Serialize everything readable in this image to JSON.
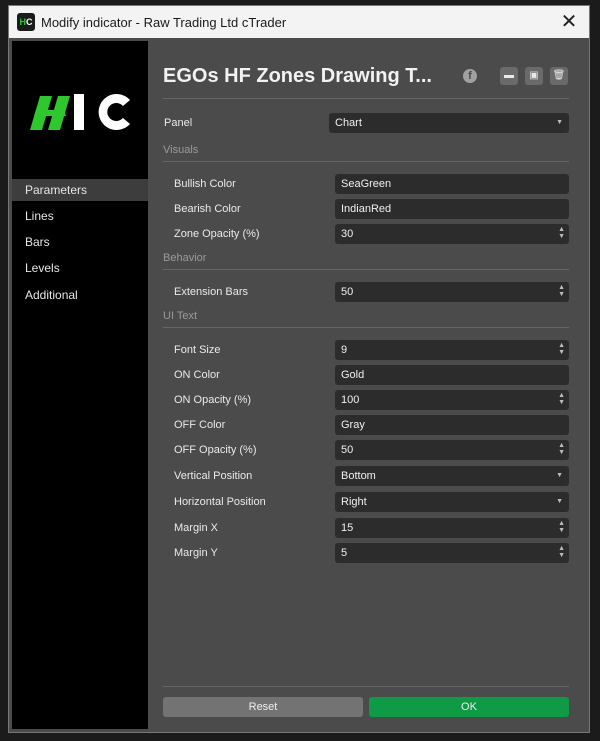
{
  "window": {
    "title": "Modify indicator - Raw Trading Ltd cTrader",
    "close_glyph": "✕"
  },
  "header": {
    "title": "EGOs HF Zones Drawing T...",
    "icons": [
      "facebook-icon",
      "open-icon",
      "save-icon",
      "delete-icon"
    ]
  },
  "sidebar": {
    "logo_text": "HC",
    "items": [
      {
        "label": "Parameters",
        "active": true
      },
      {
        "label": "Lines",
        "active": false
      },
      {
        "label": "Bars",
        "active": false
      },
      {
        "label": "Levels",
        "active": false
      },
      {
        "label": "Additional",
        "active": false
      }
    ]
  },
  "form": {
    "panel": {
      "label": "Panel",
      "value": "Chart"
    },
    "sections": [
      {
        "title": "Visuals",
        "rows": [
          {
            "label": "Bullish Color",
            "value": "SeaGreen"
          },
          {
            "label": "Bearish Color",
            "value": "IndianRed"
          },
          {
            "label": "Zone Opacity (%)",
            "value": "30"
          }
        ]
      },
      {
        "title": "Behavior",
        "rows": [
          {
            "label": "Extension Bars",
            "value": "50"
          }
        ]
      },
      {
        "title": "UI Text",
        "rows": [
          {
            "label": "Font Size",
            "value": "9"
          },
          {
            "label": "ON Color",
            "value": "Gold"
          },
          {
            "label": "ON Opacity (%)",
            "value": "100"
          },
          {
            "label": "OFF Color",
            "value": "Gray"
          },
          {
            "label": "OFF Opacity (%)",
            "value": "50"
          },
          {
            "label": "Vertical Position",
            "value": "Bottom"
          },
          {
            "label": "Horizontal Position",
            "value": "Right"
          },
          {
            "label": "Margin X",
            "value": "15"
          },
          {
            "label": "Margin Y",
            "value": "5"
          }
        ]
      }
    ]
  },
  "buttons": {
    "reset": "Reset",
    "ok": "OK"
  },
  "colors": {
    "ok_button": "#0f9a45",
    "logo_green": "#2ec82e",
    "window_bg": "#4b4b4b"
  }
}
